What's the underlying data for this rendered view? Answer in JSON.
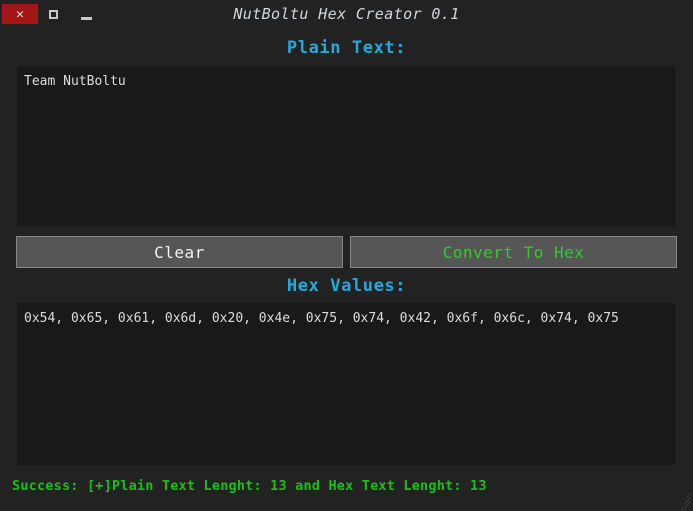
{
  "window": {
    "title": "NutBoltu Hex Creator 0.1",
    "controls": {
      "close_glyph": "✕",
      "close_name": "close-button",
      "maximize_name": "maximize-button",
      "minimize_name": "minimize-button"
    },
    "colors": {
      "background": "#222222",
      "textarea_background": "#191919",
      "heading": "#22aadd",
      "button_face": "#565656",
      "button_border": "#888888",
      "convert_text": "#2fcc2f",
      "clear_text": "#f2f2f2",
      "status_text": "#16c216",
      "close_button": "#a31616",
      "title_text": "#cfd6de"
    }
  },
  "plain_section": {
    "label": "Plain Text:",
    "value": "Team NutBoltu",
    "placeholder": ""
  },
  "buttons": {
    "clear_label": "Clear",
    "convert_label": "Convert To Hex"
  },
  "hex_section": {
    "label": "Hex Values:",
    "value": "0x54, 0x65, 0x61, 0x6d, 0x20, 0x4e, 0x75, 0x74, 0x42, 0x6f, 0x6c, 0x74, 0x75",
    "placeholder": ""
  },
  "status": {
    "message": "Success: [+]Plain Text Lenght: 13 and Hex Text Lenght: 13"
  }
}
